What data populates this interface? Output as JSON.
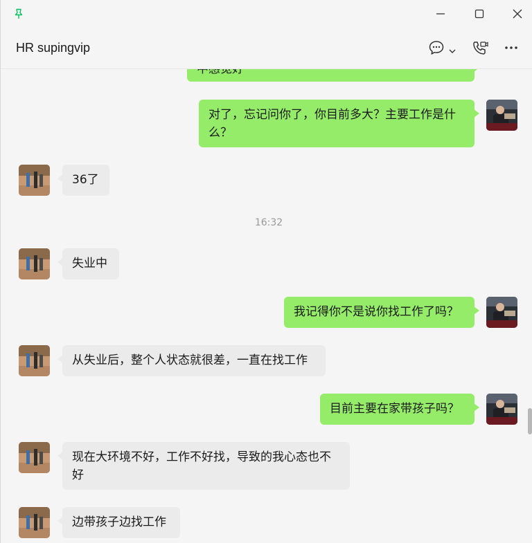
{
  "window": {
    "chat_title": "HR supingvip",
    "accent_color": "#07c160"
  },
  "icons": {
    "pin": "pin-icon",
    "minimize": "minimize-icon",
    "maximize": "maximize-icon",
    "close": "close-icon",
    "chat_menu": "chat-bubble-icon",
    "dropdown": "chevron-down-icon",
    "call": "phone-video-icon",
    "more": "more-dots-icon"
  },
  "messages": {
    "m0": "中感觉好",
    "m1": "对了，忘记问你了，你目前多大？主要工作是什么？",
    "m2": "36了",
    "time1": "16:32",
    "m3": "失业中",
    "m4": "我记得你不是说你找工作了吗？",
    "m5": "从失业后，整个人状态就很差，一直在找工作",
    "m6": "目前主要在家带孩子吗？",
    "m7": "现在大环境不好，工作不好找，导致的我心态也不好",
    "m8": "边带孩子边找工作"
  },
  "colors": {
    "outgoing_bubble": "#95ec69",
    "incoming_bubble": "#ebebeb",
    "background": "#f5f5f5"
  }
}
